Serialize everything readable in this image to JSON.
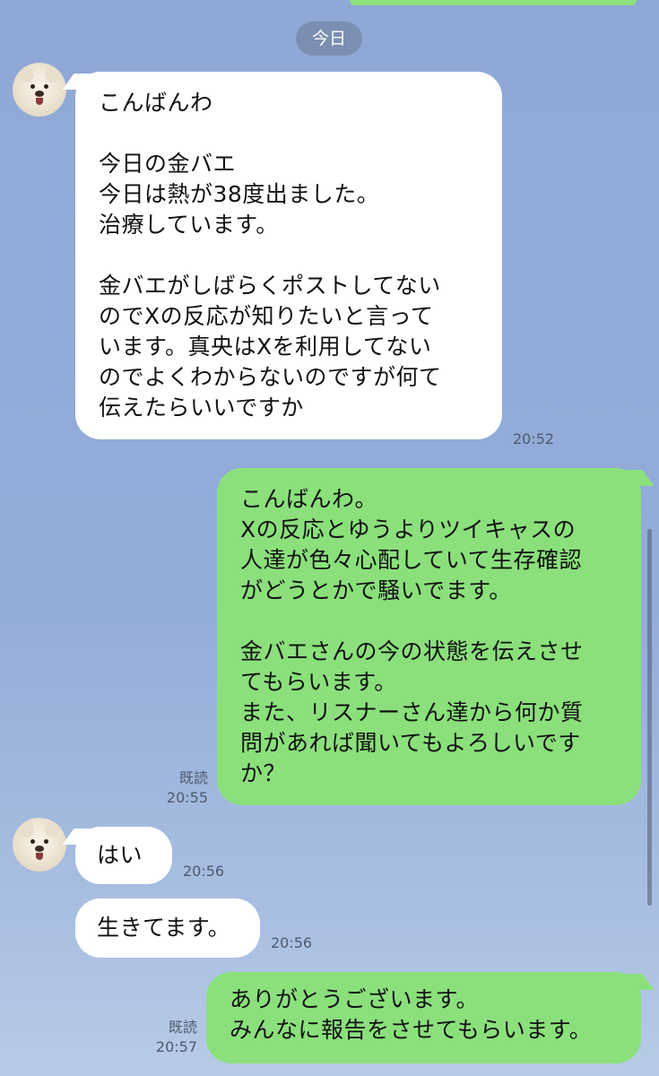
{
  "date_label": "今日",
  "messages": [
    {
      "side": "in",
      "lines": [
        "こんばんわ",
        "",
        "今日の金バエ",
        "今日は熱が38度出ました。",
        "治療しています。",
        "",
        "金バエがしばらくポストしてない",
        "のでXの反応が知りたいと言って",
        "います。真央はXを利用してない",
        "のでよくわからないのですが何て",
        "伝えたらいいですか"
      ],
      "time": "20:52"
    },
    {
      "side": "out",
      "lines": [
        "こんばんわ。",
        "Xの反応とゆうよりツイキャスの",
        "人達が色々心配していて生存確認",
        "がどうとかで騒いでます。",
        "",
        "金バエさんの今の状態を伝えさせ",
        "てもらいます。",
        "また、リスナーさん達から何か質",
        "問があれば聞いてもよろしいです",
        "か？"
      ],
      "read": "既読",
      "time": "20:55"
    },
    {
      "side": "in",
      "lines": [
        "はい"
      ],
      "time": "20:56"
    },
    {
      "side": "in",
      "lines": [
        "生きてます。"
      ],
      "time": "20:56"
    },
    {
      "side": "out",
      "lines": [
        "ありがとうございます。",
        "みんなに報告をさせてもらいます。"
      ],
      "read": "既読",
      "time": "20:57"
    }
  ],
  "colors": {
    "outgoing_bubble": "#8be07c",
    "incoming_bubble": "#ffffff",
    "background": "#93acd8"
  }
}
